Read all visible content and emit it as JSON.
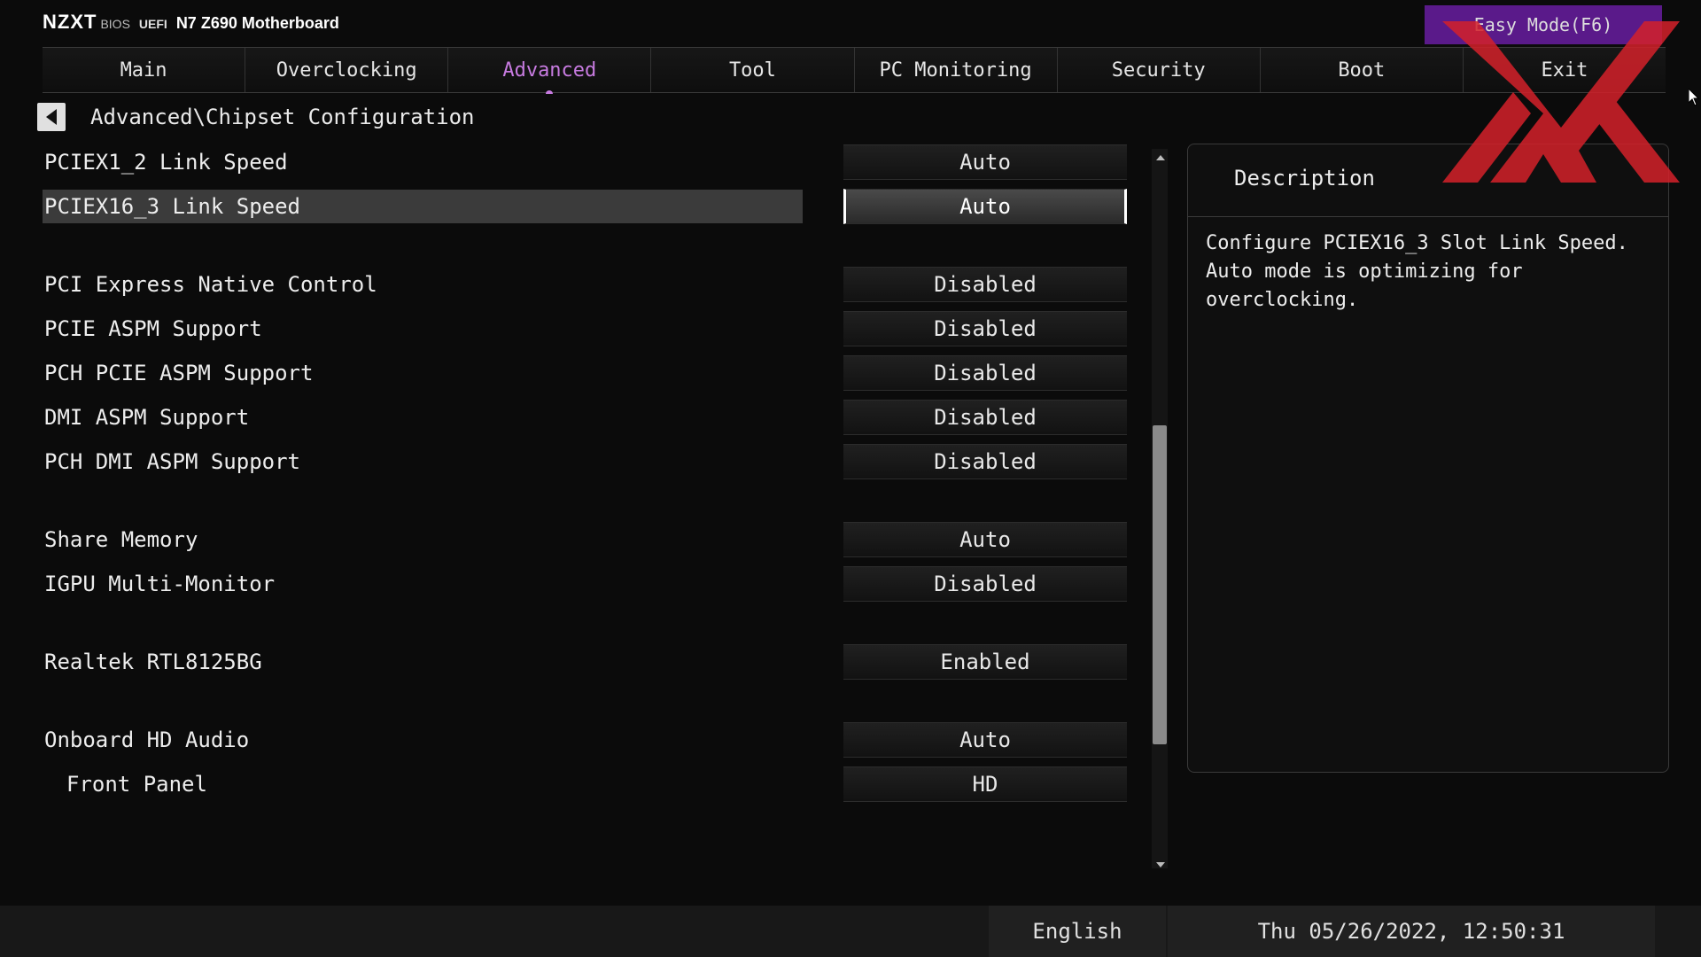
{
  "header": {
    "logo": "NZXT",
    "bios": "BIOS",
    "uefi": "UEFI",
    "model": "N7 Z690 Motherboard",
    "easy_mode": "Easy Mode(F6)"
  },
  "tabs": [
    {
      "label": "Main"
    },
    {
      "label": "Overclocking"
    },
    {
      "label": "Advanced",
      "active": true
    },
    {
      "label": "Tool"
    },
    {
      "label": "PC Monitoring"
    },
    {
      "label": "Security"
    },
    {
      "label": "Boot"
    },
    {
      "label": "Exit"
    }
  ],
  "breadcrumb": "Advanced\\Chipset Configuration",
  "settings": [
    {
      "label": "PCIEX1_2 Link Speed",
      "value": "Auto"
    },
    {
      "label": "PCIEX16_3 Link Speed",
      "value": "Auto",
      "selected": true
    },
    {
      "label": "PCI Express Native Control",
      "value": "Disabled"
    },
    {
      "label": "PCIE ASPM Support",
      "value": "Disabled"
    },
    {
      "label": "PCH PCIE ASPM Support",
      "value": "Disabled"
    },
    {
      "label": "DMI ASPM Support",
      "value": "Disabled"
    },
    {
      "label": "PCH DMI ASPM Support",
      "value": "Disabled"
    },
    {
      "label": "Share Memory",
      "value": "Auto"
    },
    {
      "label": "IGPU Multi-Monitor",
      "value": "Disabled"
    },
    {
      "label": "Realtek RTL8125BG",
      "value": "Enabled"
    },
    {
      "label": "Onboard HD Audio",
      "value": "Auto"
    },
    {
      "label": "Front Panel",
      "value": "HD",
      "indent": true
    }
  ],
  "description": {
    "title": "Description",
    "text": "Configure PCIEX16_3 Slot Link Speed.\nAuto mode is optimizing for\noverclocking."
  },
  "footer": {
    "language": "English",
    "datetime": "Thu 05/26/2022, 12:50:31"
  },
  "colors": {
    "accent": "#c77be0",
    "easy_mode_bg": "#5a1a8a",
    "watermark": "#d4212a"
  }
}
